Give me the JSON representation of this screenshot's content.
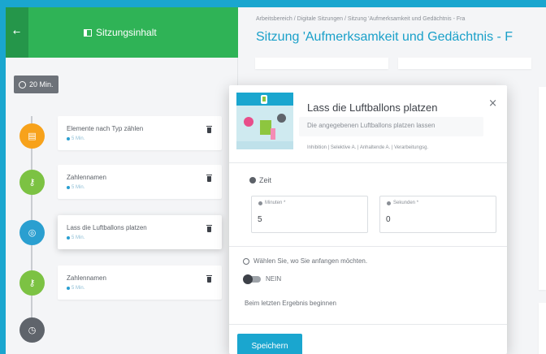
{
  "sidebar": {
    "title": "Sitzungsinhalt",
    "back_icon": "arrow-left-icon",
    "duration": "20 Min.",
    "items": [
      {
        "label": "Elemente nach Typ zählen",
        "duration": "5 Min.",
        "icon": "calendar-icon",
        "color": "#f7a21b"
      },
      {
        "label": "Zahlennamen",
        "duration": "5 Min.",
        "icon": "key-icon",
        "color": "#7cc243"
      },
      {
        "label": "Lass die Luftballons platzen",
        "duration": "5 Min.",
        "icon": "gamepad-icon",
        "color": "#2a9fd0"
      },
      {
        "label": "Zahlennamen",
        "duration": "5 Min.",
        "icon": "key-icon",
        "color": "#7cc243"
      }
    ],
    "end_icon": "clock-icon"
  },
  "header": {
    "breadcrumb": "Arbeitsbereich  /  Digitale Sitzungen  /  Sitzung 'Aufmerksamkeit und Gedächtnis - Fra",
    "title": "Sitzung 'Aufmerksamkeit und Gedächtnis - F"
  },
  "modal": {
    "title": "Lass die Luftballons platzen",
    "close": "×",
    "description": "Die angegebenen Luftballons platzen lassen",
    "tags": "Inhibition | Selektive A. | Anhaltende A. | Verarbeitungsg.",
    "time_label": "Zeit",
    "minutes_label": "Minuten *",
    "minutes_value": "5",
    "seconds_label": "Sekunden *",
    "seconds_value": "0",
    "start_question": "Wählen Sie, wo Sie anfangen möchten.",
    "toggle_label": "NEIN",
    "note": "Beim letzten Ergebnis beginnen",
    "save": "Speichern"
  },
  "colors": {
    "accent": "#1aa6cf",
    "header_green": "#2fb356"
  }
}
